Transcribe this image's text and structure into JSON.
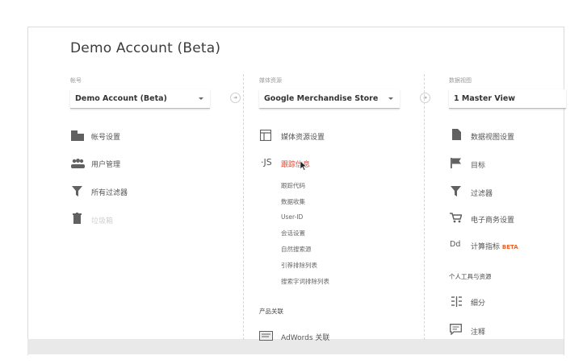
{
  "page_title": "Demo Account (Beta)",
  "account_column": {
    "label": "帐号",
    "select_value": "Demo Account (Beta)",
    "items": [
      {
        "icon": "building-icon",
        "label": "帐号设置"
      },
      {
        "icon": "users-icon",
        "label": "用户管理"
      },
      {
        "icon": "filter-icon",
        "label": "所有过滤器"
      },
      {
        "icon": "trash-icon",
        "label": "垃圾箱"
      }
    ]
  },
  "property_column": {
    "label": "媒体资源",
    "select_value": "Google Merchandise Store",
    "items": [
      {
        "icon": "window-icon",
        "label": "媒体资源设置"
      },
      {
        "icon": "js-icon",
        "icon_text": "·JS",
        "label": "跟踪信息"
      }
    ],
    "tracking_subitems": [
      "跟踪代码",
      "数据收集",
      "User-ID",
      "会话设置",
      "自然搜索源",
      "引荐排除列表",
      "搜索字词排除列表"
    ],
    "product_linking_heading": "产品关联",
    "product_links": [
      {
        "icon": "adwords-icon",
        "label": "AdWords 关联"
      }
    ]
  },
  "view_column": {
    "label": "数据视图",
    "select_value": "1 Master View",
    "items": [
      {
        "icon": "document-icon",
        "label": "数据视图设置"
      },
      {
        "icon": "flag-icon",
        "label": "目标"
      },
      {
        "icon": "filter-icon",
        "label": "过滤器"
      },
      {
        "icon": "cart-icon",
        "label": "电子商务设置"
      },
      {
        "icon": "calculated-metrics-icon",
        "icon_text": "Dd",
        "label": "计算指标",
        "badge": "BETA"
      }
    ],
    "personal_heading": "个人工具与资源",
    "personal_items": [
      {
        "icon": "segments-icon",
        "label": "细分"
      },
      {
        "icon": "annotation-icon",
        "label": "注释"
      }
    ]
  },
  "colors": {
    "accent_red": "#d84a38",
    "beta_orange": "#e8642c",
    "icon_gray": "#616161"
  }
}
